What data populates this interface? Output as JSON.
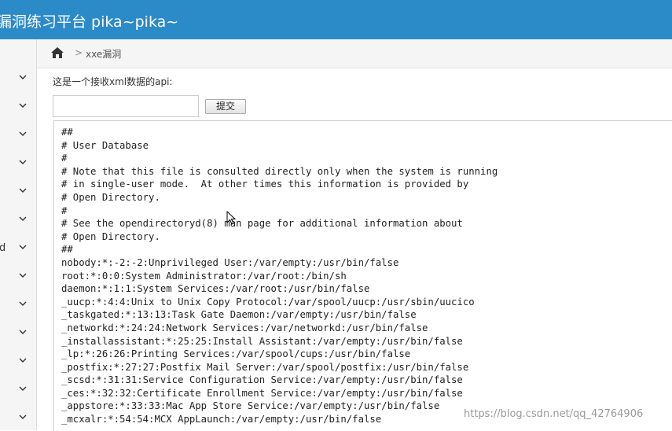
{
  "header": {
    "title": "漏洞练习平台 pika~pika~"
  },
  "sidebar": {
    "items": [
      {
        "label": ""
      },
      {
        "label": ""
      },
      {
        "label": ""
      },
      {
        "label": ""
      },
      {
        "label": ""
      },
      {
        "label": ""
      },
      {
        "label": "d"
      },
      {
        "label": ""
      },
      {
        "label": ""
      },
      {
        "label": ""
      },
      {
        "label": ""
      },
      {
        "label": ""
      },
      {
        "label": ""
      }
    ]
  },
  "breadcrumb": {
    "separator": ">",
    "current": "xxe漏洞"
  },
  "form": {
    "label": "这是一个接收xml数据的api:",
    "input_value": "",
    "submit_label": "提交"
  },
  "output": {
    "lines": [
      "##",
      "# User Database",
      "#",
      "# Note that this file is consulted directly only when the system is running",
      "# in single-user mode.  At other times this information is provided by",
      "# Open Directory.",
      "#",
      "# See the opendirectoryd(8) man page for additional information about",
      "# Open Directory.",
      "##",
      "nobody:*:-2:-2:Unprivileged User:/var/empty:/usr/bin/false",
      "root:*:0:0:System Administrator:/var/root:/bin/sh",
      "daemon:*:1:1:System Services:/var/root:/usr/bin/false",
      "_uucp:*:4:4:Unix to Unix Copy Protocol:/var/spool/uucp:/usr/sbin/uucico",
      "_taskgated:*:13:13:Task Gate Daemon:/var/empty:/usr/bin/false",
      "_networkd:*:24:24:Network Services:/var/networkd:/usr/bin/false",
      "_installassistant:*:25:25:Install Assistant:/var/empty:/usr/bin/false",
      "_lp:*:26:26:Printing Services:/var/spool/cups:/usr/bin/false",
      "_postfix:*:27:27:Postfix Mail Server:/var/spool/postfix:/usr/bin/false",
      "_scsd:*:31:31:Service Configuration Service:/var/empty:/usr/bin/false",
      "_ces:*:32:32:Certificate Enrollment Service:/var/empty:/usr/bin/false",
      "_appstore:*:33:33:Mac App Store Service:/var/empty:/usr/bin/false",
      "_mcxalr:*:54:54:MCX AppLaunch:/var/empty:/usr/bin/false"
    ]
  },
  "watermark": "https://blog.csdn.net/qq_42764906",
  "colors": {
    "header_bg": "#2b8ac8",
    "sidebar_bg": "#f2f2f2"
  }
}
